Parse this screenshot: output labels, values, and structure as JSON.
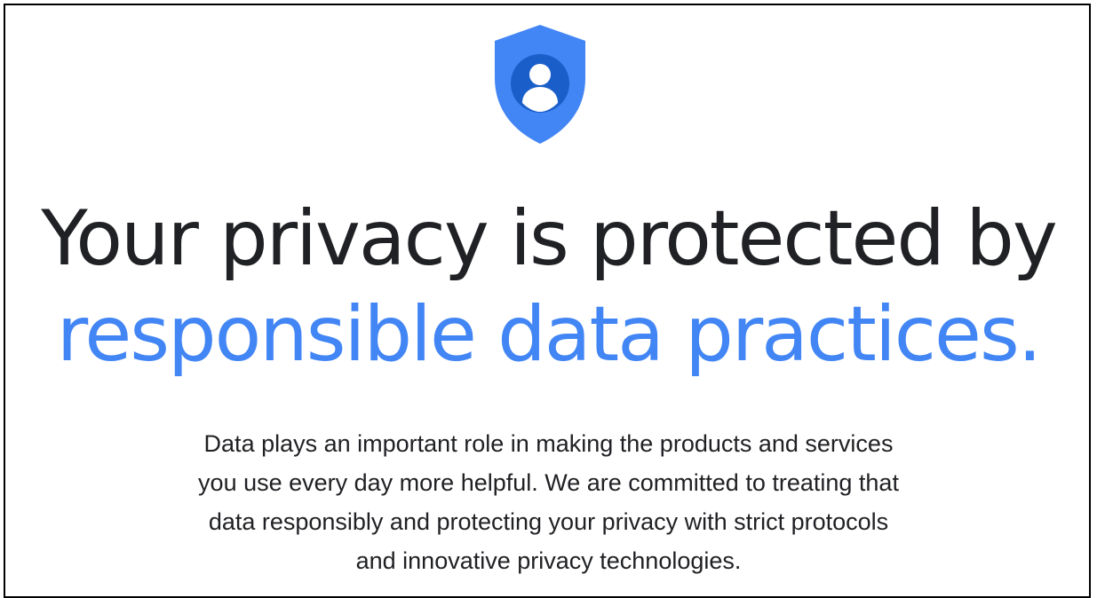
{
  "hero": {
    "icon": "privacy-shield-user-icon",
    "headline_line1": "Your privacy is protected by",
    "headline_line2": "responsible data practices.",
    "body_lines": [
      "Data plays an important role in making the products and services",
      "you use every day more helpful. We are committed to treating that",
      "data responsibly and protecting your privacy with strict protocols",
      "and innovative privacy technologies."
    ]
  },
  "colors": {
    "accent": "#4285f4",
    "shield_dark": "#1a5fc9",
    "text": "#202124",
    "background": "#ffffff"
  }
}
